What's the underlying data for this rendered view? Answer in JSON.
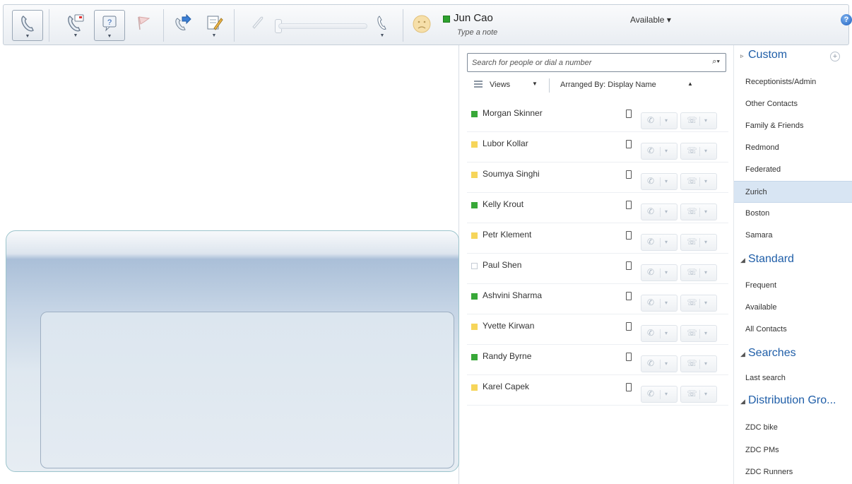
{
  "toolbar": {
    "user_name": "Jun Cao",
    "user_note": "Type a note",
    "availability": "Available ▾",
    "help_glyph": "?",
    "status_color": "#2ea22e"
  },
  "search": {
    "placeholder": "Search for people or dial a number",
    "icon": "⌕▾"
  },
  "views": {
    "label": "Views",
    "caret": "▼",
    "arranged_label": "Arranged By: Display Name",
    "arranged_caret": "▲"
  },
  "contacts": [
    {
      "name": "Morgan  Skinner",
      "presence": "available"
    },
    {
      "name": "Lubor  Kollar",
      "presence": "away"
    },
    {
      "name": "Soumya  Singhi",
      "presence": "away"
    },
    {
      "name": "Kelly  Krout",
      "presence": "available"
    },
    {
      "name": "Petr  Klement",
      "presence": "away"
    },
    {
      "name": "Paul  Shen",
      "presence": "offline"
    },
    {
      "name": "Ashvini  Sharma",
      "presence": "available"
    },
    {
      "name": "Yvette  Kirwan",
      "presence": "away"
    },
    {
      "name": "Randy  Byrne",
      "presence": "available"
    },
    {
      "name": "Karel  Capek",
      "presence": "away"
    }
  ],
  "groups": {
    "custom": {
      "title": "Custom",
      "add_glyph": "+",
      "items": [
        "Receptionists/Admin",
        "Other Contacts",
        "Family & Friends",
        "Redmond",
        "Federated",
        "Zurich",
        "Boston",
        "Samara"
      ],
      "selected": "Zurich"
    },
    "standard": {
      "title": "Standard",
      "items": [
        "Frequent",
        "Available",
        "All Contacts"
      ]
    },
    "searches": {
      "title": "Searches",
      "items": [
        "Last search"
      ]
    },
    "distribution": {
      "title": "Distribution Gro...",
      "items": [
        "ZDC bike",
        "ZDC PMs",
        "ZDC Runners"
      ]
    }
  },
  "icons": {
    "collapsed_triangle": "▹",
    "expanded_triangle": "◢",
    "call_glyph": "✆",
    "im_glyph": "☏",
    "dropdown_glyph": "▾"
  }
}
